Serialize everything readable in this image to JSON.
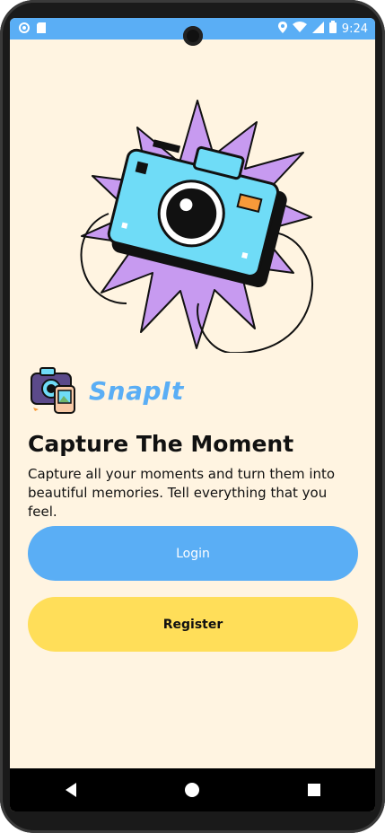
{
  "status_bar": {
    "time": "9:24"
  },
  "brand": {
    "name": "SnapIt"
  },
  "heading": {
    "title": "Capture The Moment",
    "description": "Capture all your moments and turn them into beautiful memories. Tell everything that you feel."
  },
  "buttons": {
    "login_label": "Login",
    "register_label": "Register"
  },
  "nav": {
    "back_icon": "back-triangle-icon",
    "home_icon": "home-circle-icon",
    "recents_icon": "recents-square-icon"
  },
  "colors": {
    "accent_blue": "#5aaef5",
    "accent_yellow": "#ffde59",
    "background": "#fff4e1",
    "burst_purple": "#c79af0",
    "camera_cyan": "#6fdcf7"
  }
}
